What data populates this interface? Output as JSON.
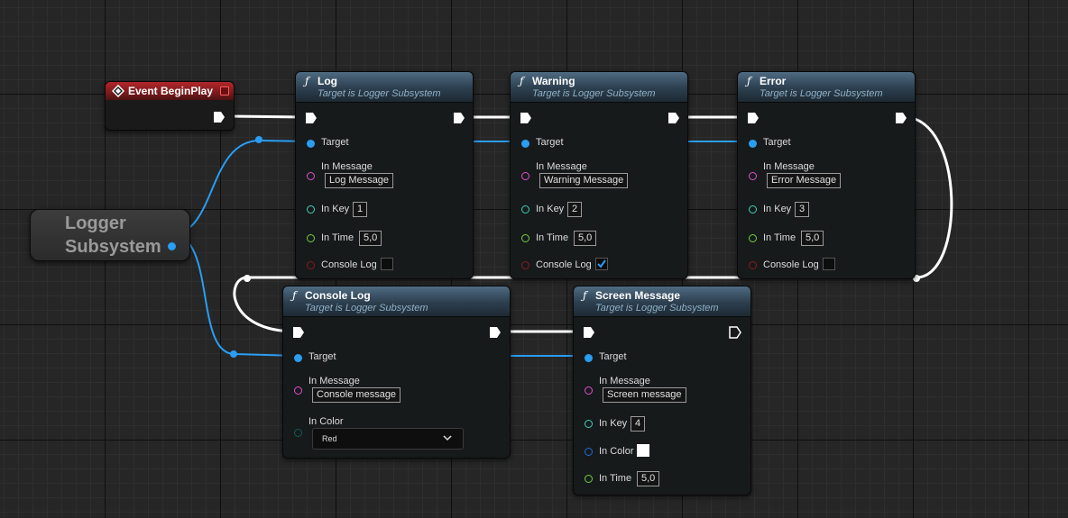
{
  "event_node": {
    "title": "Event BeginPlay"
  },
  "logger_node": {
    "title": "Logger Subsystem"
  },
  "nodes": {
    "log": {
      "title": "Log",
      "subtitle": "Target is Logger Subsystem",
      "target": "Target",
      "message_label": "In Message",
      "message_value": "Log Message",
      "key_label": "In Key",
      "key_value": "1",
      "time_label": "In Time",
      "time_value": "5,0",
      "console_label": "Console Log",
      "console_checked": false
    },
    "warning": {
      "title": "Warning",
      "subtitle": "Target is Logger Subsystem",
      "target": "Target",
      "message_label": "In Message",
      "message_value": "Warning Message",
      "key_label": "In Key",
      "key_value": "2",
      "time_label": "In Time",
      "time_value": "5,0",
      "console_label": "Console Log",
      "console_checked": true
    },
    "error": {
      "title": "Error",
      "subtitle": "Target is Logger Subsystem",
      "target": "Target",
      "message_label": "In Message",
      "message_value": "Error Message",
      "key_label": "In Key",
      "key_value": "3",
      "time_label": "In Time",
      "time_value": "5,0",
      "console_label": "Console Log",
      "console_checked": false
    },
    "console_log": {
      "title": "Console Log",
      "subtitle": "Target is Logger Subsystem",
      "target": "Target",
      "message_label": "In Message",
      "message_value": "Console message",
      "color_label": "In Color",
      "color_value": "Red"
    },
    "screen_message": {
      "title": "Screen Message",
      "subtitle": "Target is Logger Subsystem",
      "target": "Target",
      "message_label": "In Message",
      "message_value": "Screen message",
      "key_label": "In Key",
      "key_value": "4",
      "color_label": "In Color",
      "color_value": "#ffffff",
      "time_label": "In Time",
      "time_value": "5,0"
    }
  },
  "pin_colors": {
    "object": "#2a9df4",
    "string": "#e14fd1",
    "integer": "#3fd0b8",
    "float": "#70d23c",
    "bool": "#8b1a1a",
    "struct": "#1d6fd6",
    "enum": "#0f5f5a",
    "exec": "#ffffff"
  },
  "icons": {
    "function": "function-icon",
    "event": "event-diamond-icon",
    "exec": "exec-pin-icon",
    "chevron": "chevron-down-icon",
    "check": "checkmark-icon"
  }
}
